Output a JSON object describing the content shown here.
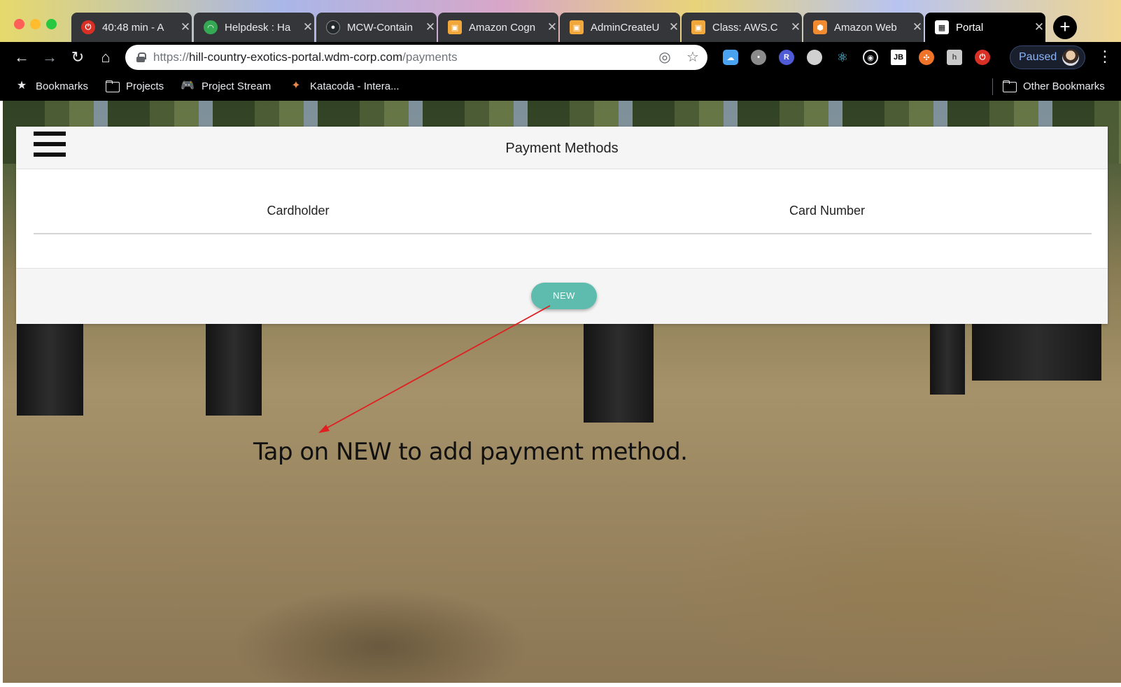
{
  "browser": {
    "tabs": [
      {
        "title": "40:48 min - A",
        "favicon": "red-power-icon",
        "color": "#d93025"
      },
      {
        "title": "Helpdesk : Ha",
        "favicon": "headset-icon",
        "color": "#34a853"
      },
      {
        "title": "MCW-Contain",
        "favicon": "github-icon",
        "color": "#24292e"
      },
      {
        "title": "Amazon Cogn",
        "favicon": "aws-box-icon",
        "color": "#f2a73b"
      },
      {
        "title": "AdminCreateU",
        "favicon": "aws-box-icon",
        "color": "#f2a73b"
      },
      {
        "title": "Class: AWS.C",
        "favicon": "aws-box-icon",
        "color": "#f2a73b"
      },
      {
        "title": "Amazon Web",
        "favicon": "aws-hex-icon",
        "color": "#f28b30"
      },
      {
        "title": "Portal",
        "favicon": "portal-icon",
        "color": "#ffffff"
      }
    ],
    "url": {
      "scheme": "https://",
      "host": "hill-country-exotics-portal.wdm-corp.com",
      "path": "/payments"
    },
    "profile_status": "Paused",
    "bookmarks": [
      {
        "label": "Bookmarks",
        "icon": "star-icon"
      },
      {
        "label": "Projects",
        "icon": "folder-icon"
      },
      {
        "label": "Project Stream",
        "icon": "gamepad-icon"
      },
      {
        "label": "Katacoda - Intera...",
        "icon": "katacoda-icon"
      }
    ],
    "other_bookmarks": "Other Bookmarks"
  },
  "app": {
    "title": "Payment Methods",
    "columns": [
      "Cardholder",
      "Card Number"
    ],
    "new_button": "NEW"
  },
  "annotation": {
    "text": "Tap on NEW to add payment method.",
    "arrow_color": "#e02020"
  }
}
